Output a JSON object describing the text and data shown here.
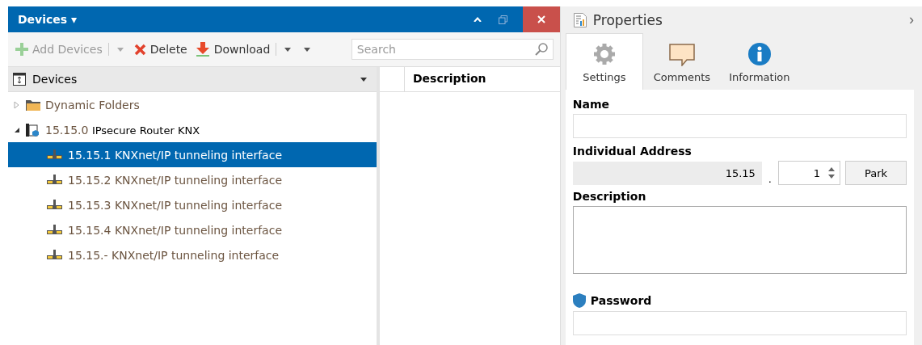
{
  "window": {
    "title": "Devices ▾"
  },
  "window_controls": [
    {
      "kind": "collapse"
    },
    {
      "kind": "restore"
    },
    {
      "kind": "close"
    }
  ],
  "toolbar": [
    {
      "kind": "add",
      "label": "Add Devices",
      "disabled": true,
      "menu": true
    },
    {
      "kind": "delete",
      "label": "Delete",
      "disabled": false,
      "menu": false
    },
    {
      "kind": "download",
      "label": "Download",
      "disabled": false,
      "menu": true
    }
  ],
  "search": {
    "placeholder": "Search"
  },
  "tree_header": {
    "label": "Devices"
  },
  "columns": [
    "Description"
  ],
  "tree": [
    {
      "kind": "folder",
      "name": "Dynamic Folders",
      "expanded": false,
      "selected": false
    },
    {
      "kind": "router",
      "address": "15.15.0",
      "name": "IPsecure Router KNX",
      "expanded": true,
      "selected": false,
      "children": [
        {
          "kind": "interface",
          "address": "15.15.1",
          "name": "KNXnet/IP tunneling interface",
          "selected": true
        },
        {
          "kind": "interface",
          "address": "15.15.2",
          "name": "KNXnet/IP tunneling interface",
          "selected": false
        },
        {
          "kind": "interface",
          "address": "15.15.3",
          "name": "KNXnet/IP tunneling interface",
          "selected": false
        },
        {
          "kind": "interface",
          "address": "15.15.4",
          "name": "KNXnet/IP tunneling interface",
          "selected": false
        },
        {
          "kind": "interface",
          "address": "15.15.-",
          "name": "KNXnet/IP tunneling interface",
          "selected": false
        }
      ]
    }
  ],
  "properties": {
    "title": "Properties",
    "collapse": "›",
    "tabs": [
      {
        "kind": "settings",
        "label": "Settings",
        "selected": true
      },
      {
        "kind": "comments",
        "label": "Comments",
        "selected": false
      },
      {
        "kind": "information",
        "label": "Information",
        "selected": false
      }
    ],
    "fields": [
      {
        "kind": "text",
        "label": "Name"
      },
      {
        "kind": "address",
        "label": "Individual Address",
        "prefix": "15.15",
        "separator": ".",
        "value": "1",
        "button": "Park"
      },
      {
        "kind": "multiline",
        "label": "Description"
      },
      {
        "kind": "password",
        "label": "Password"
      }
    ]
  }
}
